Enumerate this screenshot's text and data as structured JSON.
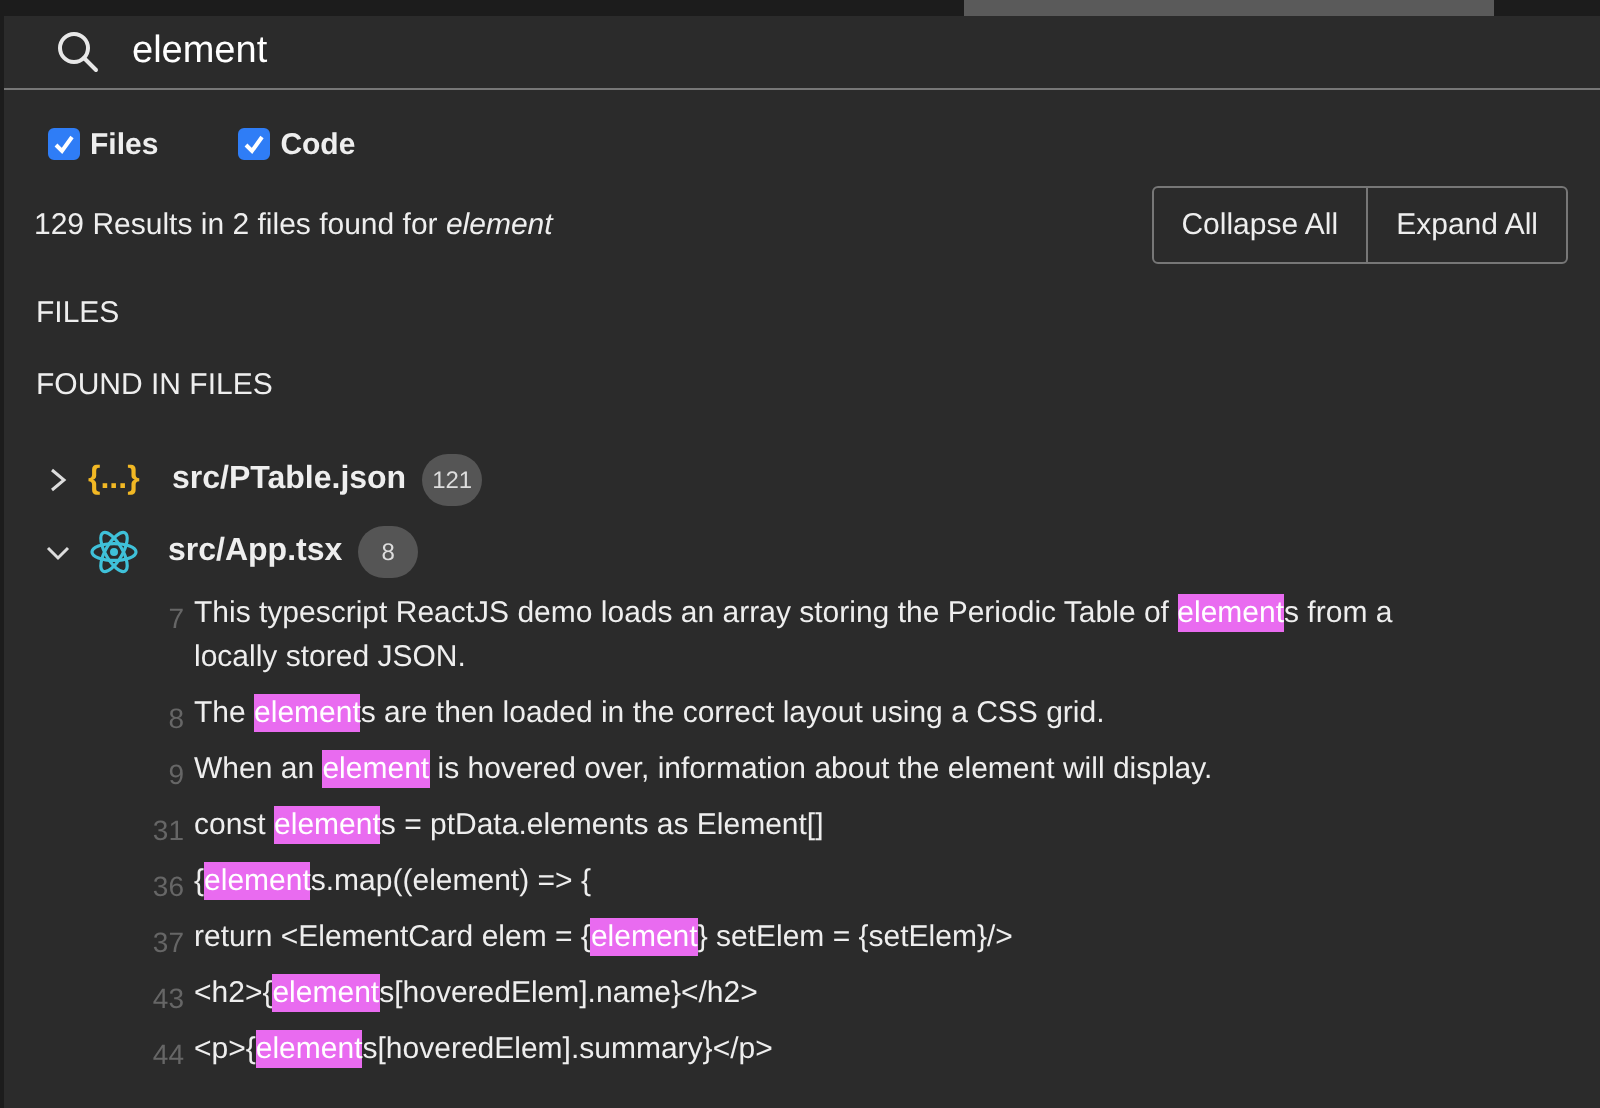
{
  "search": {
    "value": "element"
  },
  "filters": [
    {
      "label": "Files",
      "checked": true
    },
    {
      "label": "Code",
      "checked": true
    }
  ],
  "summary": {
    "text": "129 Results in 2 files found for ",
    "term": "element"
  },
  "buttons": [
    "Collapse All",
    "Expand All"
  ],
  "sections": [
    "FILES",
    "FOUND IN FILES"
  ],
  "files": [
    {
      "kind": "json",
      "icon_text": "{...}",
      "name": "src/PTable.json",
      "count": "121",
      "expanded": false
    },
    {
      "kind": "react",
      "name": "src/App.tsx",
      "count": "8",
      "expanded": true
    }
  ],
  "results": [
    {
      "line": "7",
      "parts": [
        {
          "text": "This typescript ReactJS demo loads an array storing the Periodic Table of "
        },
        {
          "text": "element",
          "match": true
        },
        {
          "text": "s from a locally stored JSON."
        }
      ]
    },
    {
      "line": "8",
      "parts": [
        {
          "text": "The "
        },
        {
          "text": "element",
          "match": true
        },
        {
          "text": "s are then loaded in the correct layout using a CSS grid."
        }
      ]
    },
    {
      "line": "9",
      "parts": [
        {
          "text": "When an "
        },
        {
          "text": "element",
          "match": true
        },
        {
          "text": " is hovered over, information about the element will display."
        }
      ]
    },
    {
      "line": "31",
      "parts": [
        {
          "text": "const "
        },
        {
          "text": "element",
          "match": true
        },
        {
          "text": "s = ptData.elements as Element[]"
        }
      ]
    },
    {
      "line": "36",
      "parts": [
        {
          "text": "{"
        },
        {
          "text": "element",
          "match": true
        },
        {
          "text": "s.map((element) => {"
        }
      ]
    },
    {
      "line": "37",
      "parts": [
        {
          "text": "return <ElementCard elem = {"
        },
        {
          "text": "element",
          "match": true
        },
        {
          "text": "} setElem = {setElem}/>"
        }
      ]
    },
    {
      "line": "43",
      "parts": [
        {
          "text": "<h2>{"
        },
        {
          "text": "element",
          "match": true
        },
        {
          "text": "s[hoveredElem].name}</h2>"
        }
      ]
    },
    {
      "line": "44",
      "parts": [
        {
          "text": "<p>{"
        },
        {
          "text": "element",
          "match": true
        },
        {
          "text": "s[hoveredElem].summary}</p>"
        }
      ]
    }
  ]
}
